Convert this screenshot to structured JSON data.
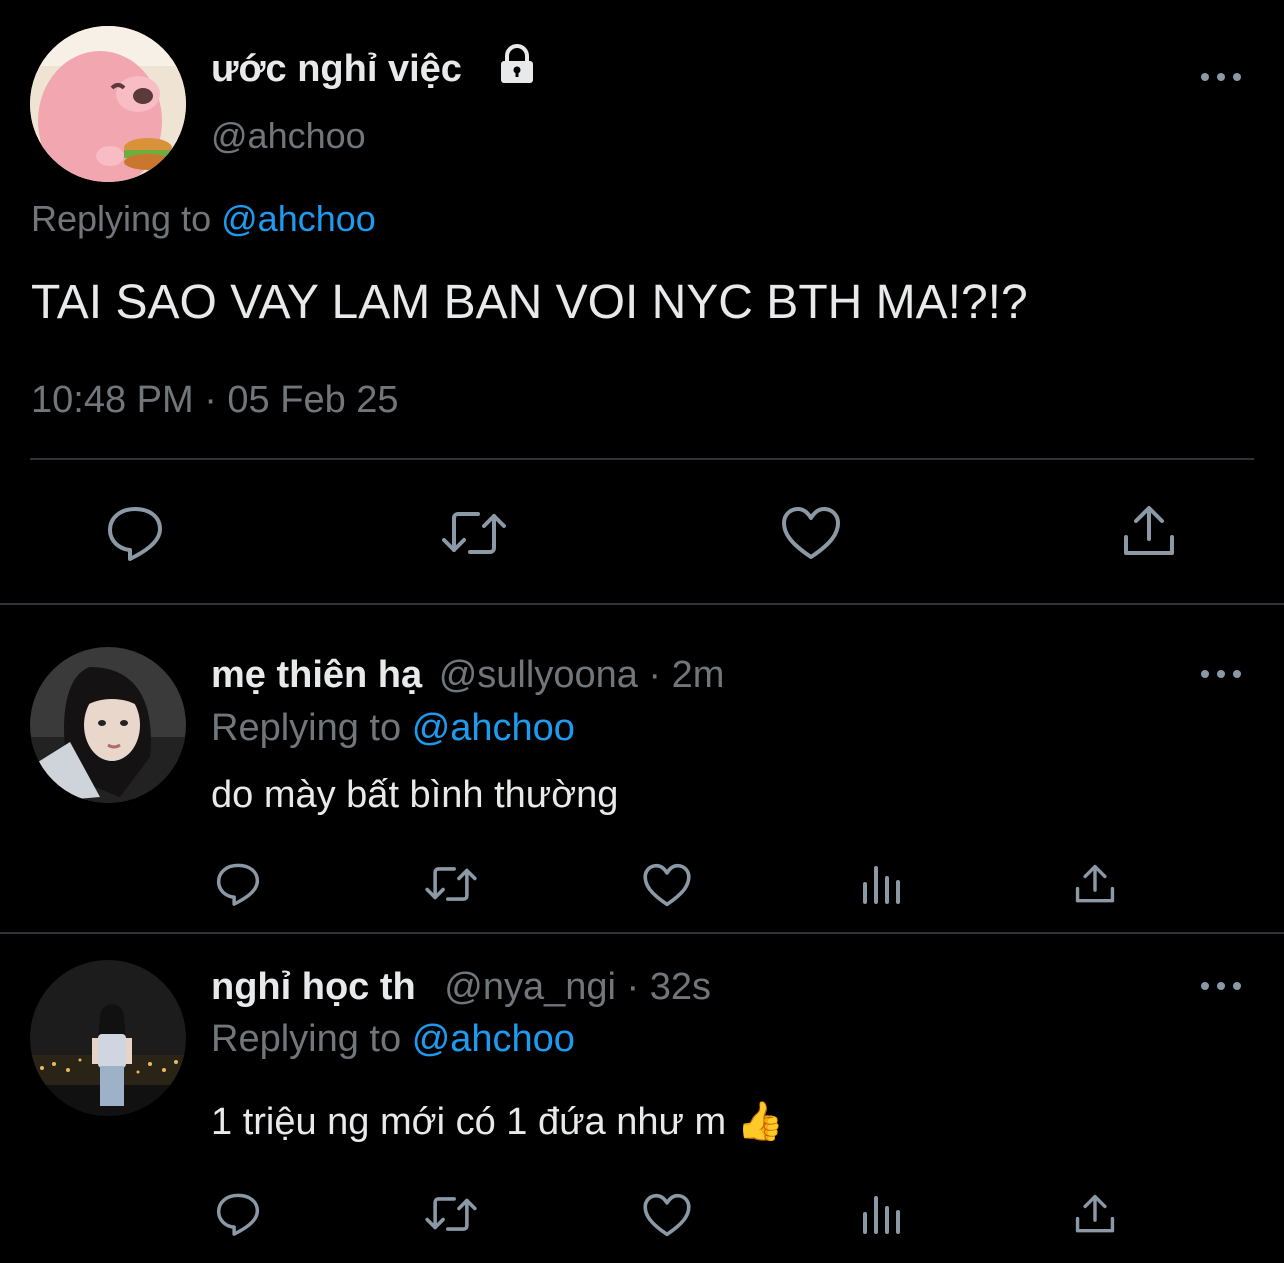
{
  "main_tweet": {
    "display_name": "ước nghỉ việc",
    "handle": "@ahchoo",
    "replying_prefix": "Replying to",
    "replying_to": "@ahchoo",
    "text": "TAI SAO VAY LAM BAN VOI NYC BTH MA!?!?",
    "timestamp": "10:48 PM · 05 Feb 25"
  },
  "replies": [
    {
      "display_name": "mẹ thiên hạ",
      "handle": "@sullyoona",
      "sep": "·",
      "time": "2m",
      "replying_prefix": "Replying to",
      "replying_to": "@ahchoo",
      "text": "do mày bất bình thường"
    },
    {
      "display_name": "nghỉ học th",
      "handle": "@nya_ngi",
      "sep": "·",
      "time": "32s",
      "replying_prefix": "Replying to",
      "replying_to": "@ahchoo",
      "text": "1 triệu ng mới có 1 đứa như m",
      "emoji": "👍"
    }
  ],
  "colors": {
    "background": "#000000",
    "text": "#e7e9ea",
    "muted": "#71767b",
    "link": "#1d9bf0",
    "divider": "#2f3336"
  }
}
